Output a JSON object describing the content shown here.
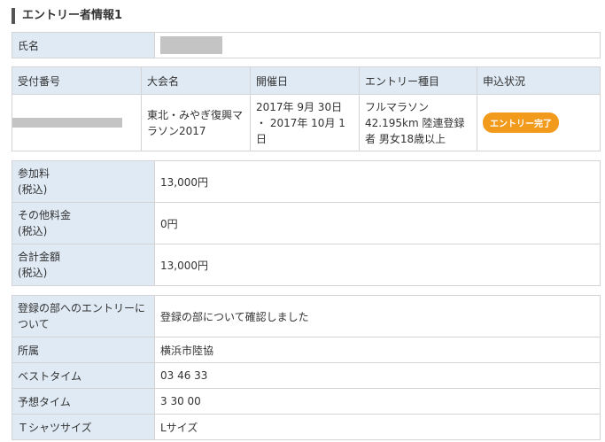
{
  "section_title": "エントリー者情報1",
  "name_row": {
    "label": "氏名"
  },
  "entry_table": {
    "headers": [
      "受付番号",
      "大会名",
      "開催日",
      "エントリー種目",
      "申込状況"
    ],
    "row": {
      "event_name": "東北・みやぎ復興マラソン2017",
      "date": "2017年 9月 30日 ・ 2017年 10月 1日",
      "category": "フルマラソン 42.195km 陸連登録者 男女18歳以上",
      "status": "エントリー完了"
    },
    "status_color": "#f29a1b"
  },
  "fees": [
    {
      "label": "参加料\n(税込)",
      "value": "13,000円"
    },
    {
      "label": "その他料金\n(税込)",
      "value": "0円"
    },
    {
      "label": "合計金額\n(税込)",
      "value": "13,000円"
    }
  ],
  "details": [
    {
      "label": "登録の部へのエントリーについて",
      "value": "登録の部について確認しました"
    },
    {
      "label": "所属",
      "value": "横浜市陸協"
    },
    {
      "label": "ベストタイム",
      "value": "03 46 33"
    },
    {
      "label": "予想タイム",
      "value": "3 30 00"
    },
    {
      "label": "Ｔシャツサイズ",
      "value": "Lサイズ"
    }
  ],
  "colors": {
    "label_bg": "#dfeaf4",
    "border": "#d4d4d4",
    "redaction": "#c4c4c4"
  }
}
